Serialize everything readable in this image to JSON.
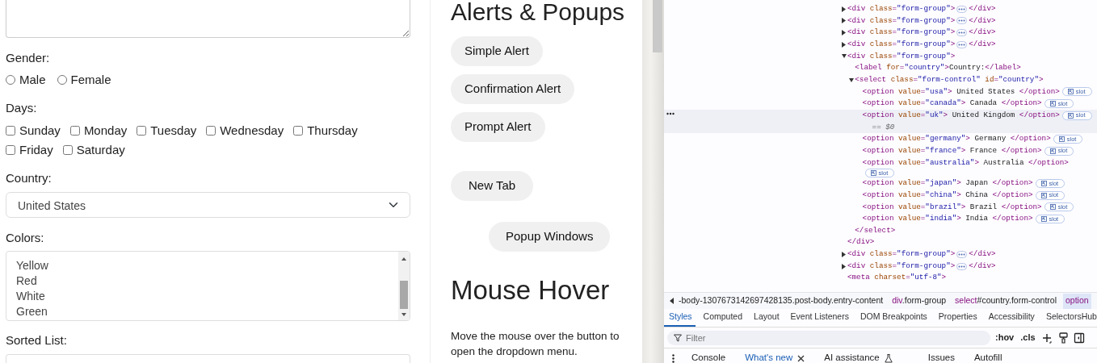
{
  "form": {
    "gender": {
      "label": "Gender:",
      "options": [
        {
          "label": "Male",
          "selected": false
        },
        {
          "label": "Female",
          "selected": false
        }
      ]
    },
    "days": {
      "label": "Days:",
      "options": [
        {
          "label": "Sunday",
          "checked": false
        },
        {
          "label": "Monday",
          "checked": false
        },
        {
          "label": "Tuesday",
          "checked": false
        },
        {
          "label": "Wednesday",
          "checked": false
        },
        {
          "label": "Thursday",
          "checked": false
        },
        {
          "label": "Friday",
          "checked": false
        },
        {
          "label": "Saturday",
          "checked": false
        }
      ]
    },
    "country": {
      "label": "Country:",
      "value": "United States"
    },
    "colors": {
      "label": "Colors:",
      "options": [
        {
          "label": "Yellow",
          "selected": false
        },
        {
          "label": "Red",
          "selected": false
        },
        {
          "label": "White",
          "selected": false
        },
        {
          "label": "Green",
          "selected": false
        }
      ]
    },
    "sorted_list": {
      "label": "Sorted List:"
    }
  },
  "alerts": {
    "title": "Alerts & Popups",
    "buttons": [
      {
        "label": "Simple Alert",
        "kind": "alert"
      },
      {
        "label": "Confirmation Alert",
        "kind": "alert"
      },
      {
        "label": "Prompt Alert",
        "kind": "alert"
      },
      {
        "label": "New Tab",
        "kind": "tab"
      },
      {
        "label": "Popup Windows",
        "kind": "popup"
      }
    ]
  },
  "mouse_hover": {
    "title": "Mouse Hover",
    "text": "Move the mouse over the button to open the dropdown menu."
  },
  "devtools": {
    "dom_tree": [
      {
        "tag": "<div class=\"form-group\">",
        "expanded": false,
        "close_tag": "</div>",
        "selected": false
      },
      {
        "tag": "<div class=\"form-group\">",
        "expanded": false,
        "close_tag": "</div>",
        "selected": false
      },
      {
        "tag": "<div class=\"form-group\">",
        "expanded": false,
        "close_tag": "</div>",
        "selected": false
      },
      {
        "tag": "<div class=\"form-group\">",
        "expanded": false,
        "close_tag": "</div>",
        "selected": false
      },
      {
        "tag": "<div class=\"form-group\">",
        "expanded": true,
        "close_tag": "</div>",
        "selected": false,
        "children": [
          {
            "tag": "<label for=\"country\">",
            "text": "Country:",
            "close_tag": "</label>",
            "selected": false
          },
          {
            "tag": "<select class=\"form-control\" id=\"country\">",
            "expanded": true,
            "close_tag": "</select>",
            "selected": false,
            "children": [
              {
                "tag": "<option value=\"usa\">",
                "text": "United States",
                "close_tag": "</option>",
                "slot": "slot",
                "selected": false
              },
              {
                "tag": "<option value=\"canada\">",
                "text": "Canada",
                "close_tag": "</option>",
                "slot": "slot",
                "selected": false
              },
              {
                "tag": "<option value=\"uk\">",
                "text": "United Kingdom",
                "close_tag": "</option>",
                "slot": "slot",
                "selected": true
              },
              {
                "tag": "<option value=\"germany\">",
                "text": "Germany",
                "close_tag": "</option>",
                "slot": "slot",
                "selected": false
              },
              {
                "tag": "<option value=\"france\">",
                "text": "France",
                "close_tag": "</option>",
                "slot": "slot",
                "selected": false
              },
              {
                "tag": "<option value=\"australia\">",
                "text": "Australia",
                "close_tag": "</option>",
                "slot": "slot",
                "selected": false
              },
              {
                "tag": "<option value=\"japan\">",
                "text": "Japan",
                "close_tag": "</option>",
                "slot": "slot",
                "selected": false
              },
              {
                "tag": "<option value=\"china\">",
                "text": "China",
                "close_tag": "</option>",
                "slot": "slot",
                "selected": false
              },
              {
                "tag": "<option value=\"brazil\">",
                "text": "Brazil",
                "close_tag": "</option>",
                "slot": "slot",
                "selected": false
              },
              {
                "tag": "<option value=\"india\">",
                "text": "India",
                "close_tag": "</option>",
                "slot": "slot",
                "selected": false
              }
            ]
          }
        ]
      },
      {
        "tag": "<div class=\"form-group\">",
        "expanded": false,
        "close_tag": "</div>",
        "selected": false
      },
      {
        "tag": "<div class=\"form-group\">",
        "expanded": false,
        "close_tag": "</div>",
        "selected": false
      },
      {
        "tag": "<meta charset=\"utf-8\">",
        "selected": false
      }
    ],
    "selected_note": "== $0",
    "breadcrumbs": [
      {
        "label": "-body-1307673142697428135.post-body.entry-content",
        "selected": false
      },
      {
        "label": "div.form-group",
        "selected": false
      },
      {
        "label": "select#country.form-control",
        "selected": false
      },
      {
        "label": "option",
        "selected": true
      }
    ],
    "tabs": [
      {
        "label": "Styles",
        "selected": true
      },
      {
        "label": "Computed",
        "selected": false
      },
      {
        "label": "Layout",
        "selected": false
      },
      {
        "label": "Event Listeners",
        "selected": false
      },
      {
        "label": "DOM Breakpoints",
        "selected": false
      },
      {
        "label": "Properties",
        "selected": false
      },
      {
        "label": "Accessibility",
        "selected": false
      },
      {
        "label": "SelectorsHub",
        "selected": false
      }
    ],
    "filter": {
      "placeholder": "Filter"
    },
    "toolbar_buttons": [
      ":hov",
      ".cls"
    ],
    "drawer_tabs": [
      {
        "label": "Console",
        "selected": false,
        "kind": "plain"
      },
      {
        "label": "What's new",
        "selected": true,
        "kind": "closable"
      },
      {
        "label": "AI assistance",
        "selected": false,
        "kind": "experimental"
      },
      {
        "label": "Issues",
        "selected": false,
        "kind": "plain"
      },
      {
        "label": "Autofill",
        "selected": false,
        "kind": "plain"
      }
    ]
  }
}
